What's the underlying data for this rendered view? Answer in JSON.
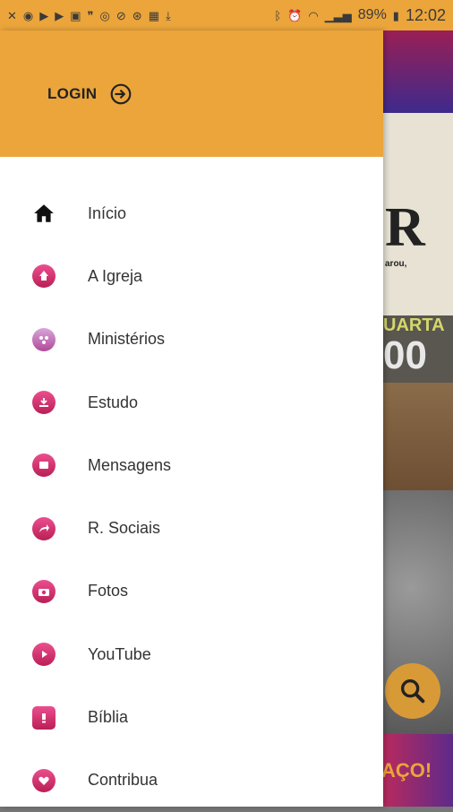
{
  "status_bar": {
    "battery": "89%",
    "time": "12:02"
  },
  "drawer": {
    "login_label": "LOGIN",
    "menu": [
      {
        "label": "Início",
        "icon": "home-icon"
      },
      {
        "label": "A Igreja",
        "icon": "church-icon"
      },
      {
        "label": "Ministérios",
        "icon": "ministries-icon"
      },
      {
        "label": "Estudo",
        "icon": "study-icon"
      },
      {
        "label": "Mensagens",
        "icon": "messages-icon"
      },
      {
        "label": "R. Sociais",
        "icon": "share-icon"
      },
      {
        "label": "Fotos",
        "icon": "camera-icon"
      },
      {
        "label": "YouTube",
        "icon": "play-icon"
      },
      {
        "label": "Bíblia",
        "icon": "bible-icon"
      },
      {
        "label": "Contribua",
        "icon": "heart-gift-icon"
      }
    ]
  },
  "background": {
    "banner_letter": "R",
    "banner_small": "arou,",
    "banner_day": "UARTA",
    "banner_time": "00",
    "bottom_text": "AÇO!"
  },
  "colors": {
    "accent": "#eba53b",
    "icon_pink": "#d6336c"
  }
}
